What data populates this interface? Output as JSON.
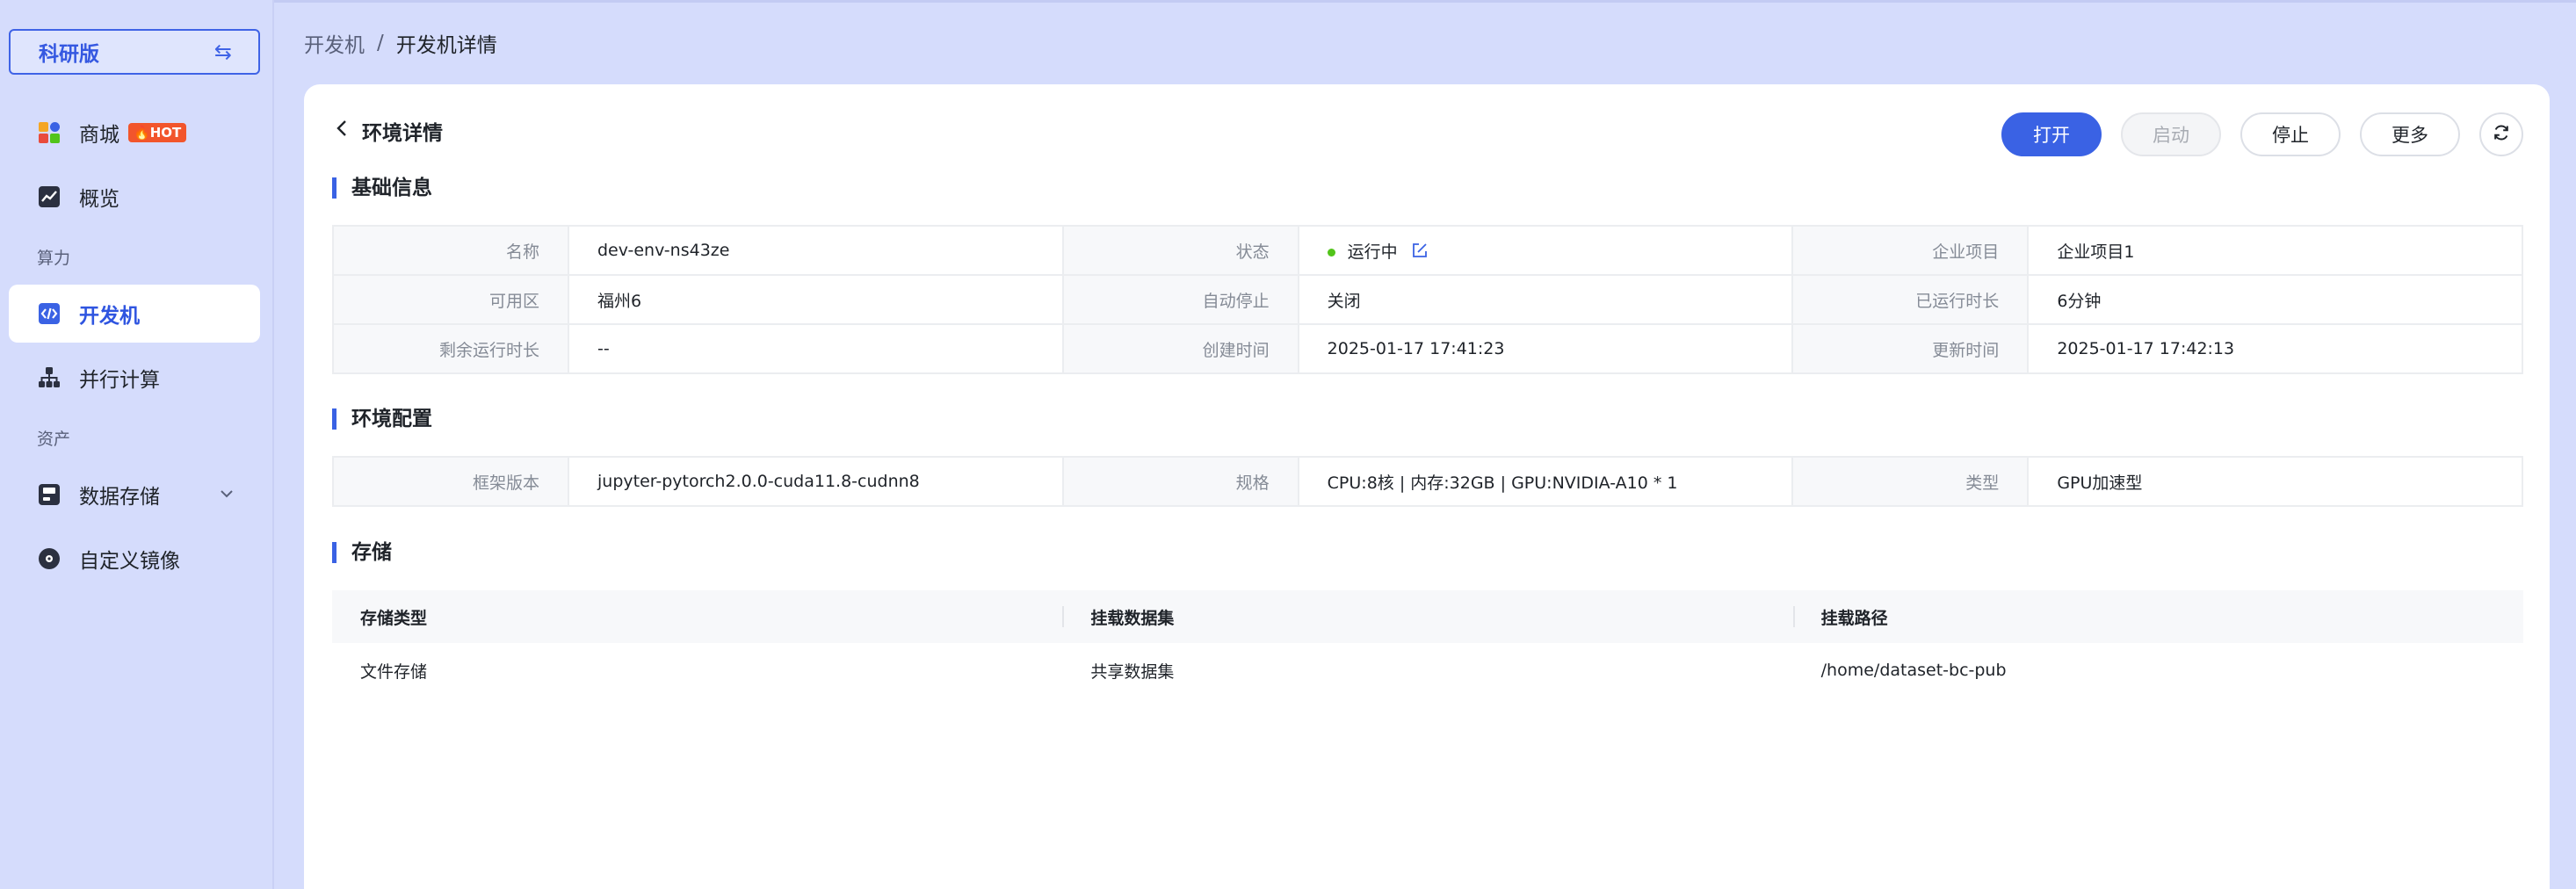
{
  "sidebar": {
    "edition_label": "科研版",
    "swap_glyph": "⇆",
    "items": [
      {
        "label": "商城",
        "badge": "HOT",
        "icon": "store-icon"
      },
      {
        "label": "概览",
        "icon": "chart-icon"
      },
      {
        "label": "开发机",
        "icon": "code-icon",
        "active": true
      },
      {
        "label": "并行计算",
        "icon": "cluster-icon"
      },
      {
        "label": "数据存储",
        "icon": "storage-icon"
      },
      {
        "label": "自定义镜像",
        "icon": "disc-icon"
      }
    ],
    "groups": [
      "算力",
      "资产"
    ]
  },
  "breadcrumb": {
    "parent": "开发机",
    "sep": "/",
    "current": "开发机详情"
  },
  "header": {
    "title": "环境详情"
  },
  "actions": {
    "open": "打开",
    "start": "启动",
    "stop": "停止",
    "more": "更多"
  },
  "sections": {
    "basic": "基础信息",
    "env": "环境配置",
    "storage": "存储"
  },
  "basic": {
    "name_label": "名称",
    "name": "dev-env-ns43ze",
    "status_label": "状态",
    "status": "运行中",
    "project_label": "企业项目",
    "project": "企业项目1",
    "zone_label": "可用区",
    "zone": "福州6",
    "autostop_label": "自动停止",
    "autostop": "关闭",
    "runtime_label": "已运行时长",
    "runtime": "6分钟",
    "remain_label": "剩余运行时长",
    "remain": "--",
    "created_label": "创建时间",
    "created": "2025-01-17 17:41:23",
    "updated_label": "更新时间",
    "updated": "2025-01-17 17:42:13"
  },
  "env": {
    "framework_label": "框架版本",
    "framework": "jupyter-pytorch2.0.0-cuda11.8-cudnn8",
    "spec_label": "规格",
    "spec": "CPU:8核 | 内存:32GB | GPU:NVIDIA-A10 * 1",
    "type_label": "类型",
    "type": "GPU加速型"
  },
  "storage": {
    "columns": [
      "存储类型",
      "挂载数据集",
      "挂载路径"
    ],
    "rows": [
      [
        "文件存储",
        "共享数据集",
        "/home/dataset-bc-pub"
      ]
    ]
  },
  "colors": {
    "accent": "#3a62e4",
    "sidebar_bg": "#d5dcfc",
    "hot": "#f2552c",
    "status_ok": "#52c41a"
  }
}
